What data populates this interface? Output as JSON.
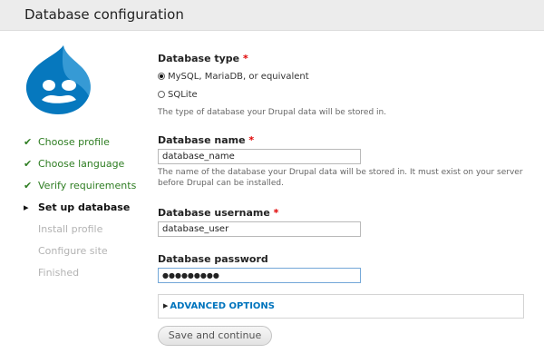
{
  "page_title": "Database configuration",
  "steps": [
    {
      "label": "Choose profile",
      "state": "done",
      "mark": "✔"
    },
    {
      "label": "Choose language",
      "state": "done",
      "mark": "✔"
    },
    {
      "label": "Verify requirements",
      "state": "done",
      "mark": "✔"
    },
    {
      "label": "Set up database",
      "state": "active",
      "mark": "▸"
    },
    {
      "label": "Install profile",
      "state": "todo",
      "mark": ""
    },
    {
      "label": "Configure site",
      "state": "todo",
      "mark": ""
    },
    {
      "label": "Finished",
      "state": "todo",
      "mark": ""
    }
  ],
  "form": {
    "db_type": {
      "label": "Database type",
      "required_mark": "*",
      "options": [
        {
          "label": "MySQL, MariaDB, or equivalent",
          "selected": true
        },
        {
          "label": "SQLite",
          "selected": false
        }
      ],
      "description": "The type of database your Drupal data will be stored in."
    },
    "db_name": {
      "label": "Database name",
      "required_mark": "*",
      "value": "database_name",
      "description_line1": "The name of the database your Drupal data will be stored in. It must exist on your server",
      "description_line2": "before Drupal can be installed."
    },
    "db_user": {
      "label": "Database username",
      "required_mark": "*",
      "value": "database_user"
    },
    "db_pass": {
      "label": "Database password",
      "value": "●●●●●●●●●"
    },
    "advanced_label": "ADVANCED OPTIONS",
    "submit_label": "Save and continue"
  },
  "colors": {
    "header_bg": "#ececec",
    "done_step": "#2e7d22",
    "required": "#e00000",
    "link": "#0074bd",
    "logo_blue": "#0678be"
  },
  "icons": {
    "logo": "drupal-drop-logo",
    "step_done": "check-icon",
    "step_active": "arrow-right-icon",
    "advanced_toggle": "triangle-right-icon"
  }
}
